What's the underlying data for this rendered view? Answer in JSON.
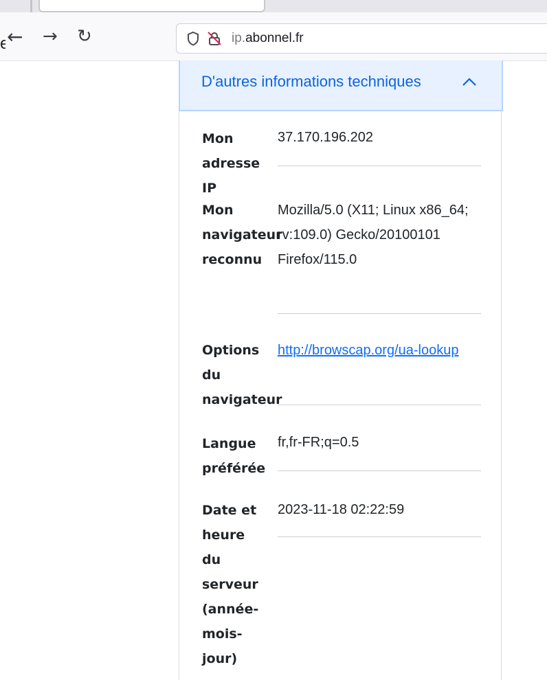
{
  "browser": {
    "clipped_text": "e",
    "url": {
      "subdomain": "ip.",
      "domain": "abonnel.fr"
    }
  },
  "accordion": {
    "title": "D'autres informations techniques"
  },
  "rows": {
    "ip": {
      "label": "Mon adresse IP",
      "value": "37.170.196.202"
    },
    "browser": {
      "label": "Mon navigateur reconnu",
      "value": "Mozilla/5.0 (X11; Linux x86_64; rv:109.0) Gecko/20100101 Firefox/115.0"
    },
    "options": {
      "label": "Options du navigateur",
      "value": "http://browscap.org/ua-lookup"
    },
    "language": {
      "label": "Langue préférée",
      "value": "fr,fr-FR;q=0.5"
    },
    "datetime": {
      "label": "Date et heure du serveur (année-mois-jour)",
      "value": "2023-11-18 02:22:59"
    }
  }
}
